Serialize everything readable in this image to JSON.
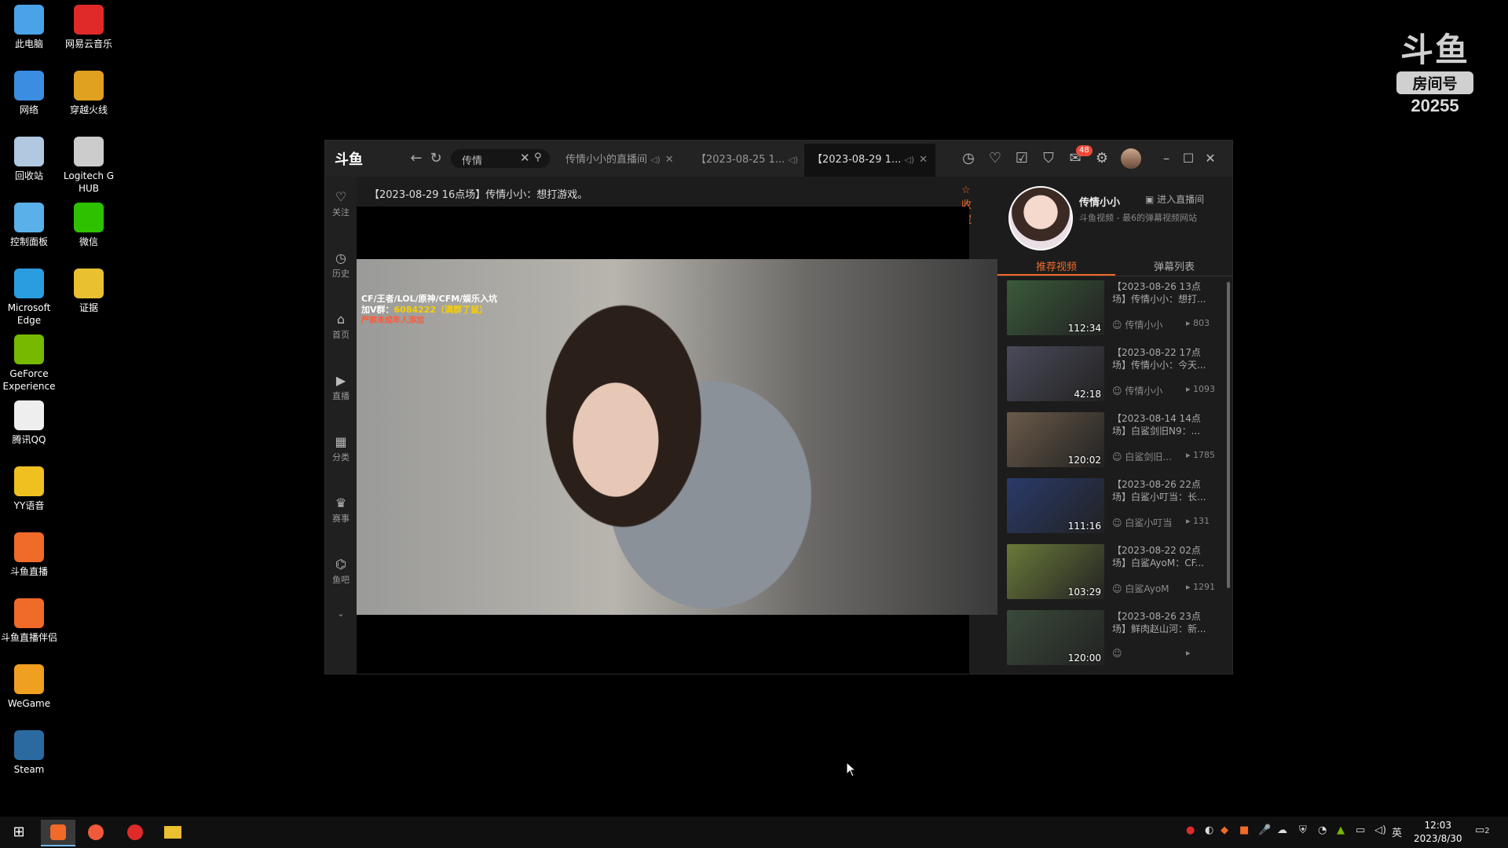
{
  "desktop": {
    "icons": [
      {
        "label": "此电脑",
        "icon": "computer-icon",
        "color": "#4aa3e8"
      },
      {
        "label": "网易云音乐",
        "icon": "netease-music-icon",
        "color": "#e02a2a"
      },
      {
        "label": "网络",
        "icon": "network-icon",
        "color": "#3a8de0"
      },
      {
        "label": "穿越火线",
        "icon": "crossfire-icon",
        "color": "#e0a020"
      },
      {
        "label": "回收站",
        "icon": "recycle-bin-icon",
        "color": "#b0c8e0"
      },
      {
        "label": "Logitech G HUB",
        "icon": "logitech-icon",
        "color": "#cccccc"
      },
      {
        "label": "控制面板",
        "icon": "control-panel-icon",
        "color": "#5ab0e8"
      },
      {
        "label": "微信",
        "icon": "wechat-icon",
        "color": "#2dc100"
      },
      {
        "label": "Microsoft Edge",
        "icon": "edge-icon",
        "color": "#2a9de0"
      },
      {
        "label": "证据",
        "icon": "folder-icon",
        "color": "#e8c030"
      },
      {
        "label": "GeForce Experience",
        "icon": "geforce-icon",
        "color": "#76b900"
      },
      {
        "label": "腾讯QQ",
        "icon": "qq-icon",
        "color": "#eeeeee"
      },
      {
        "label": "YY语音",
        "icon": "yy-icon",
        "color": "#f0c020"
      },
      {
        "label": "斗鱼直播",
        "icon": "douyu-icon",
        "color": "#f06a2a"
      },
      {
        "label": "斗鱼直播伴侣",
        "icon": "douyu-companion-icon",
        "color": "#f06a2a"
      },
      {
        "label": "WeGame",
        "icon": "wegame-icon",
        "color": "#f0a020"
      },
      {
        "label": "Steam",
        "icon": "steam-icon",
        "color": "#2a6aa0"
      }
    ]
  },
  "watermark": {
    "brand": "斗鱼",
    "room_label": "房间号",
    "room_number": "20255"
  },
  "app": {
    "logo": "斗鱼",
    "search": {
      "value": "传情"
    },
    "tabs": [
      {
        "label": "传情小小的直播间"
      },
      {
        "label": "【2023-08-25 1..."
      },
      {
        "label": "【2023-08-29 1..."
      }
    ],
    "notification_badge": "48",
    "rail": [
      {
        "label": "关注",
        "icon": "heart-icon"
      },
      {
        "label": "历史",
        "icon": "clock-icon"
      },
      {
        "label": "首页",
        "icon": "home-icon"
      },
      {
        "label": "直播",
        "icon": "live-icon"
      },
      {
        "label": "分类",
        "icon": "grid-icon"
      },
      {
        "label": "赛事",
        "icon": "trophy-icon"
      },
      {
        "label": "鱼吧",
        "icon": "fish-icon"
      }
    ],
    "video_title": "【2023-08-29 16点场】传情小小：想打游戏。",
    "favorite_label": "收藏",
    "overlay": {
      "line1": "CF/王者/LOL/原神/CFM/娱乐入坑",
      "line2_prefix": "加V群：",
      "line2_value": "6084222（满群了鼠）",
      "line3": "严禁未成年人添加"
    },
    "streamer": {
      "name": "传情小小",
      "enter_label": "进入直播间",
      "desc": "斗鱼视频 - 最6的弹幕视频网站"
    },
    "side_tabs": [
      {
        "label": "推荐视频"
      },
      {
        "label": "弹幕列表"
      }
    ],
    "videos": [
      {
        "title": "【2023-08-26 13点场】传情小小：想打...",
        "duration": "112:34",
        "author": "传情小小",
        "plays": "803",
        "thumb": "#3a5a3a"
      },
      {
        "title": "【2023-08-22 17点场】传情小小：今天...",
        "duration": "42:18",
        "author": "传情小小",
        "plays": "1093",
        "thumb": "#4a4a5a"
      },
      {
        "title": "【2023-08-14 14点场】白鲨剑旧N9：...",
        "duration": "120:02",
        "author": "白鲨剑旧...",
        "plays": "1785",
        "thumb": "#6a5a4a"
      },
      {
        "title": "【2023-08-26 22点场】白鲨小叮当：长...",
        "duration": "111:16",
        "author": "白鲨小叮当",
        "plays": "131",
        "thumb": "#2a3a6a"
      },
      {
        "title": "【2023-08-22 02点场】白鲨AyoM：CF...",
        "duration": "103:29",
        "author": "白鲨AyoM",
        "plays": "1291",
        "thumb": "#6a7a3a"
      },
      {
        "title": "【2023-08-26 23点场】鲜肉赵山河：新...",
        "duration": "120:00",
        "author": "",
        "plays": "",
        "thumb": "#3a4a3a"
      }
    ]
  },
  "taskbar": {
    "ime": "英",
    "time": "12:03",
    "date": "2023/8/30",
    "notif_count": "2"
  }
}
